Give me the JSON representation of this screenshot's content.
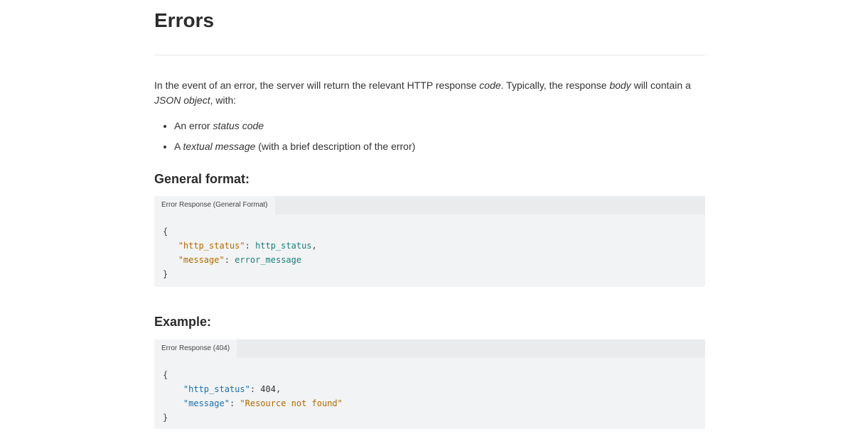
{
  "page": {
    "title": "Errors",
    "intro": {
      "part1": "In the event of an error, the server will return the relevant HTTP response ",
      "code_word": "code",
      "part2": ". Typically, the response ",
      "body_word": "body",
      "part3": " will contain a ",
      "json_word": "JSON object",
      "part4": ", with:"
    },
    "bullets": [
      {
        "prefix": "An error ",
        "em": "status code",
        "suffix": ""
      },
      {
        "prefix": "A ",
        "em": "textual message",
        "suffix": " (with a brief description of the error)"
      }
    ]
  },
  "general": {
    "heading": "General format:",
    "tab_label": "Error Response (General Format)",
    "code": {
      "open": "{",
      "k1": "\"http_status\"",
      "sep1": ": ",
      "v1": "http_status",
      "comma1": ",",
      "k2": "\"message\"",
      "sep2": ": ",
      "v2": "error_message",
      "close": "}"
    }
  },
  "example": {
    "heading": "Example:",
    "tab_label": "Error Response (404)",
    "code": {
      "open": "{",
      "k1": "\"http_status\"",
      "sep1": ": ",
      "v1": "404",
      "comma1": ",",
      "k2": "\"message\"",
      "sep2": ": ",
      "v2": "\"Resource not found\"",
      "close": "}"
    }
  },
  "colors": {
    "code_bg": "#f2f3f4",
    "tabbar_bg": "#eaebed",
    "key_orange": "#b26a00",
    "value_teal": "#1a7f7a",
    "key_blue": "#1a6fb3"
  }
}
